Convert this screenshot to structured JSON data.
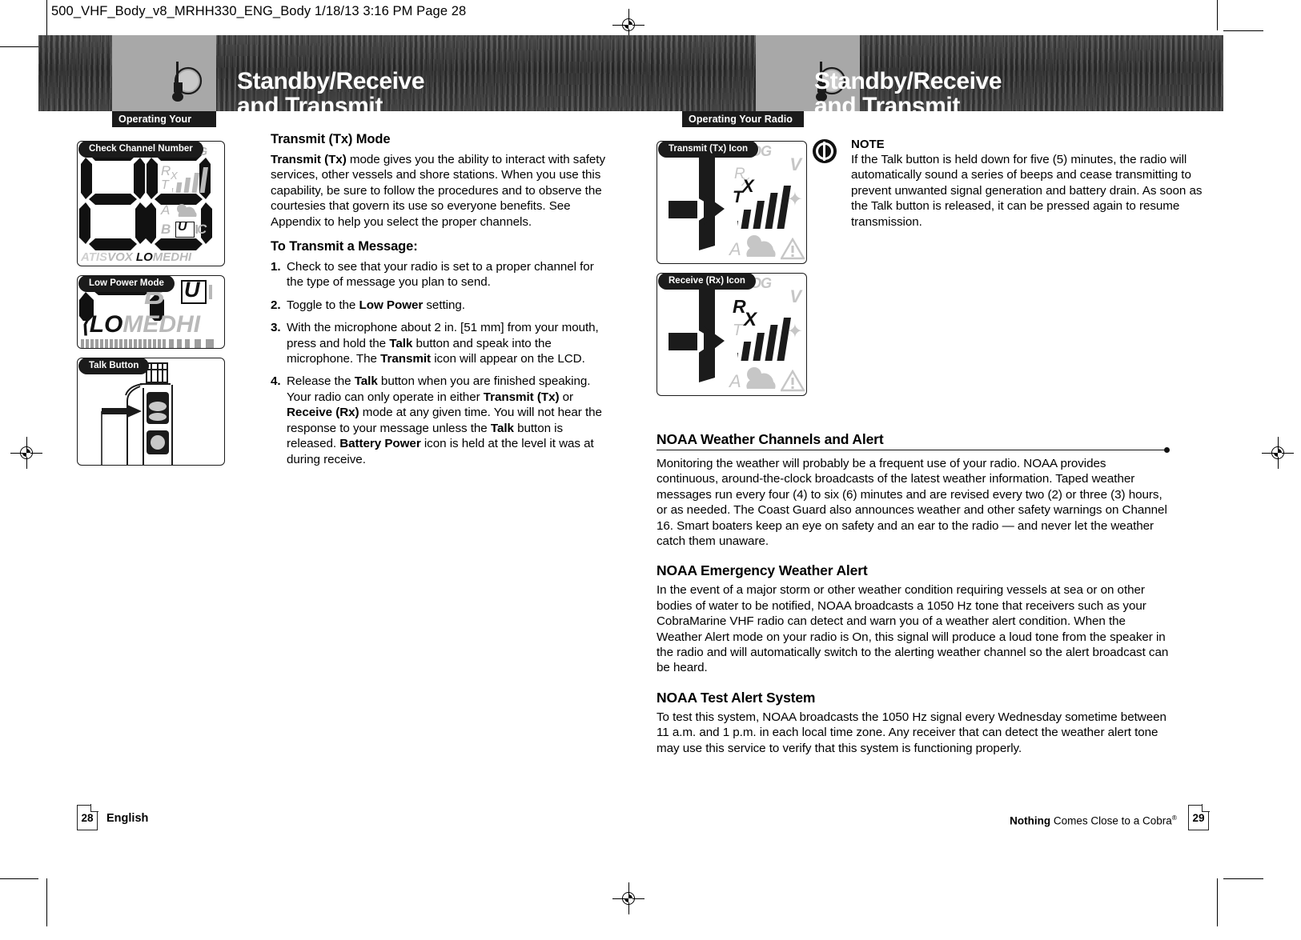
{
  "slug": "500_VHF_Body_v8_MRHH330_ENG_Body  1/18/13  3:16 PM  Page 28",
  "header": {
    "tag": "Operating Your Radio",
    "title_line1": "Standby/Receive",
    "title_line2": "and Transmit",
    "icon": "handheld-radio-icon"
  },
  "left_page": {
    "callouts": [
      {
        "label": "Check Channel Number",
        "lcd": {
          "digits": "88",
          "icons_dim": [
            "ROG",
            "music-note",
            "RX",
            "TX",
            "signal-bars",
            "A",
            "weather-cloud",
            "B",
            "C",
            "ATIS",
            "VOX",
            "MEDHI"
          ],
          "icons_on": [
            "U",
            "LO"
          ]
        }
      },
      {
        "label": "Low Power Mode",
        "lcd": {
          "digits": "",
          "icons_dim": [
            "B",
            "MEDHI"
          ],
          "icons_on": [
            "U",
            "LO"
          ]
        }
      },
      {
        "label": "Talk Button",
        "lcd": {
          "digits": "",
          "icons_dim": [],
          "icons_on": []
        }
      }
    ],
    "heading": "Transmit (Tx) Mode",
    "intro_bold": "Transmit (Tx)",
    "intro_rest": " mode gives you the ability to interact with safety services, other vessels and shore stations. When you use this capability, be sure to follow the procedures and to observe the courtesies that govern its use so everyone benefits. See Appendix to help you select the proper channels.",
    "steps_heading": "To Transmit a Message:",
    "steps": [
      {
        "num": "1.",
        "text": "Check to see that your radio is set to a proper channel for the type of message you plan to send."
      },
      {
        "num": "2.",
        "text": "Toggle to the Low Power setting.",
        "bold_terms": [
          "Low Power"
        ]
      },
      {
        "num": "3.",
        "text": "With the microphone about 2 in. [51 mm] from your mouth, press and hold the Talk button and speak into the microphone. The Transmit icon will appear on the LCD.",
        "bold_terms": [
          "Talk",
          "Transmit"
        ]
      },
      {
        "num": "4.",
        "text": "Release the Talk button when you are finished speaking. Your radio can only operate in either Transmit (Tx) or Receive (Rx) mode at any given time. You will not hear the response to your message unless the Talk button is released. Battery Power icon is held at the level it was at during receive.",
        "bold_terms": [
          "Talk",
          "Transmit (Tx)",
          "Receive (Rx)",
          "Battery Power"
        ]
      }
    ],
    "footer": {
      "page_number": "28",
      "label": "English"
    }
  },
  "right_page": {
    "callouts": [
      {
        "label": "Transmit (Tx) Icon"
      },
      {
        "label": "Receive (Rx) Icon"
      }
    ],
    "note": {
      "title": "NOTE",
      "text": "If the Talk button is held down for five (5) minutes, the radio will automatically sound a series of beeps and cease transmitting to prevent unwanted signal generation and battery drain. As soon as the Talk button is released, it can be pressed again to resume transmission."
    },
    "sections": [
      {
        "heading": "NOAA Weather Channels and Alert",
        "rule": true,
        "text": "Monitoring the weather will probably be a frequent use of your radio. NOAA provides continuous, around-the-clock broadcasts of the latest weather information. Taped weather messages run every four (4) to six (6) minutes and are revised every two (2) or three (3) hours, or as needed. The Coast Guard also announces weather and other safety warnings on Channel 16. Smart boaters keep an eye on safety and an ear to the radio — and never let the weather catch them unaware."
      },
      {
        "heading": "NOAA Emergency Weather Alert",
        "rule": false,
        "text": "In the event of a major storm or other weather condition requiring vessels at sea or on other bodies of water to be notified, NOAA broadcasts a 1050 Hz tone that receivers such as your CobraMarine VHF radio can detect and warn you of a weather alert condition. When the Weather Alert mode on your radio is On, this signal will produce a loud tone from the speaker in the radio and will automatically switch to the alerting weather channel so the alert broadcast can be heard."
      },
      {
        "heading": "NOAA Test Alert System",
        "rule": false,
        "text": "To test this system, NOAA broadcasts the 1050 Hz signal every Wednesday sometime between 11 a.m. and 1 p.m. in each local time zone. Any receiver that can detect the weather alert tone may use this service to verify that this system is functioning properly."
      }
    ],
    "footer": {
      "page_number": "29",
      "tagline_bold": "Nothing",
      "tagline_rest": " Comes Close to a Cobra",
      "tagline_sup": "®"
    }
  },
  "colors": {
    "band": "#3a3a3a",
    "tag_bg": "#1b1b1b",
    "icon_panel": "#a8a8a8",
    "lcd_dim": "#b9b9b9",
    "ink": "#111111"
  }
}
